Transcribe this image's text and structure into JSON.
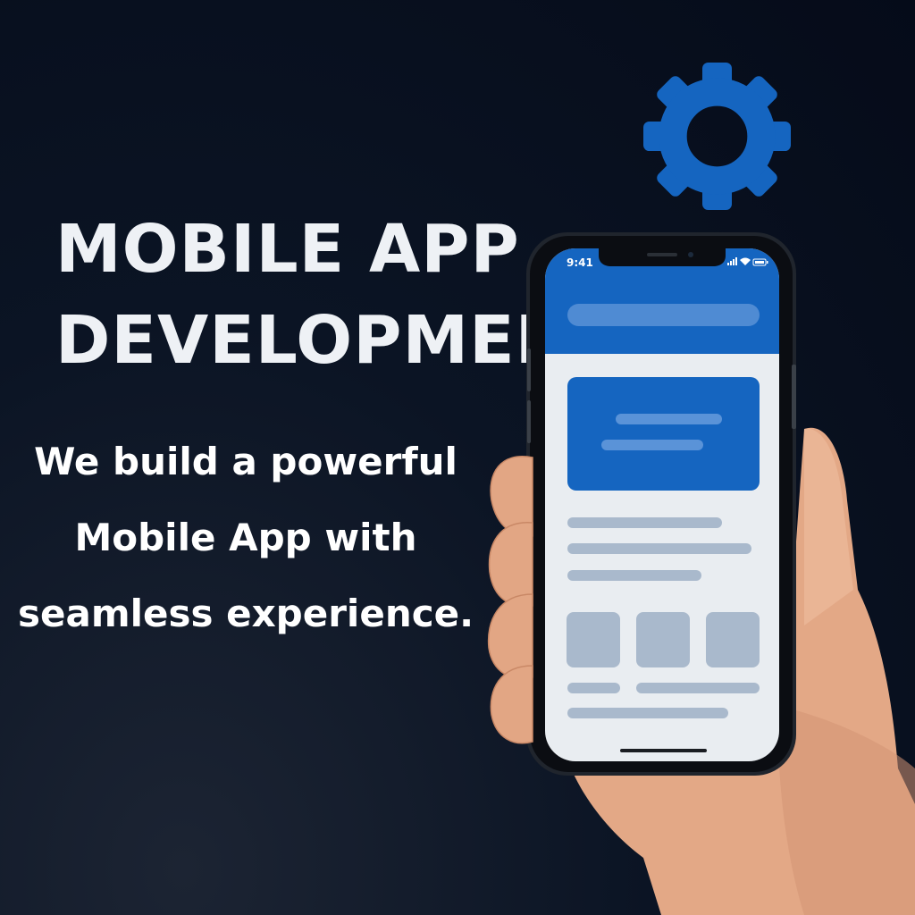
{
  "headline": {
    "line1": "MOBILE APP",
    "line2": "DEVELOPMENT"
  },
  "tagline": {
    "line1": "We build a powerful",
    "line2": "Mobile App with",
    "line3": "seamless experience."
  },
  "phone": {
    "status_time": "9:41"
  },
  "colors": {
    "background": "#050b19",
    "accent_blue": "#1565c0",
    "text": "#eef1f5",
    "placeholder": "#a9b9cc"
  },
  "icons": {
    "gear": "gear-icon",
    "signal": "cellular-signal-icon",
    "wifi": "wifi-icon",
    "battery": "battery-icon"
  }
}
